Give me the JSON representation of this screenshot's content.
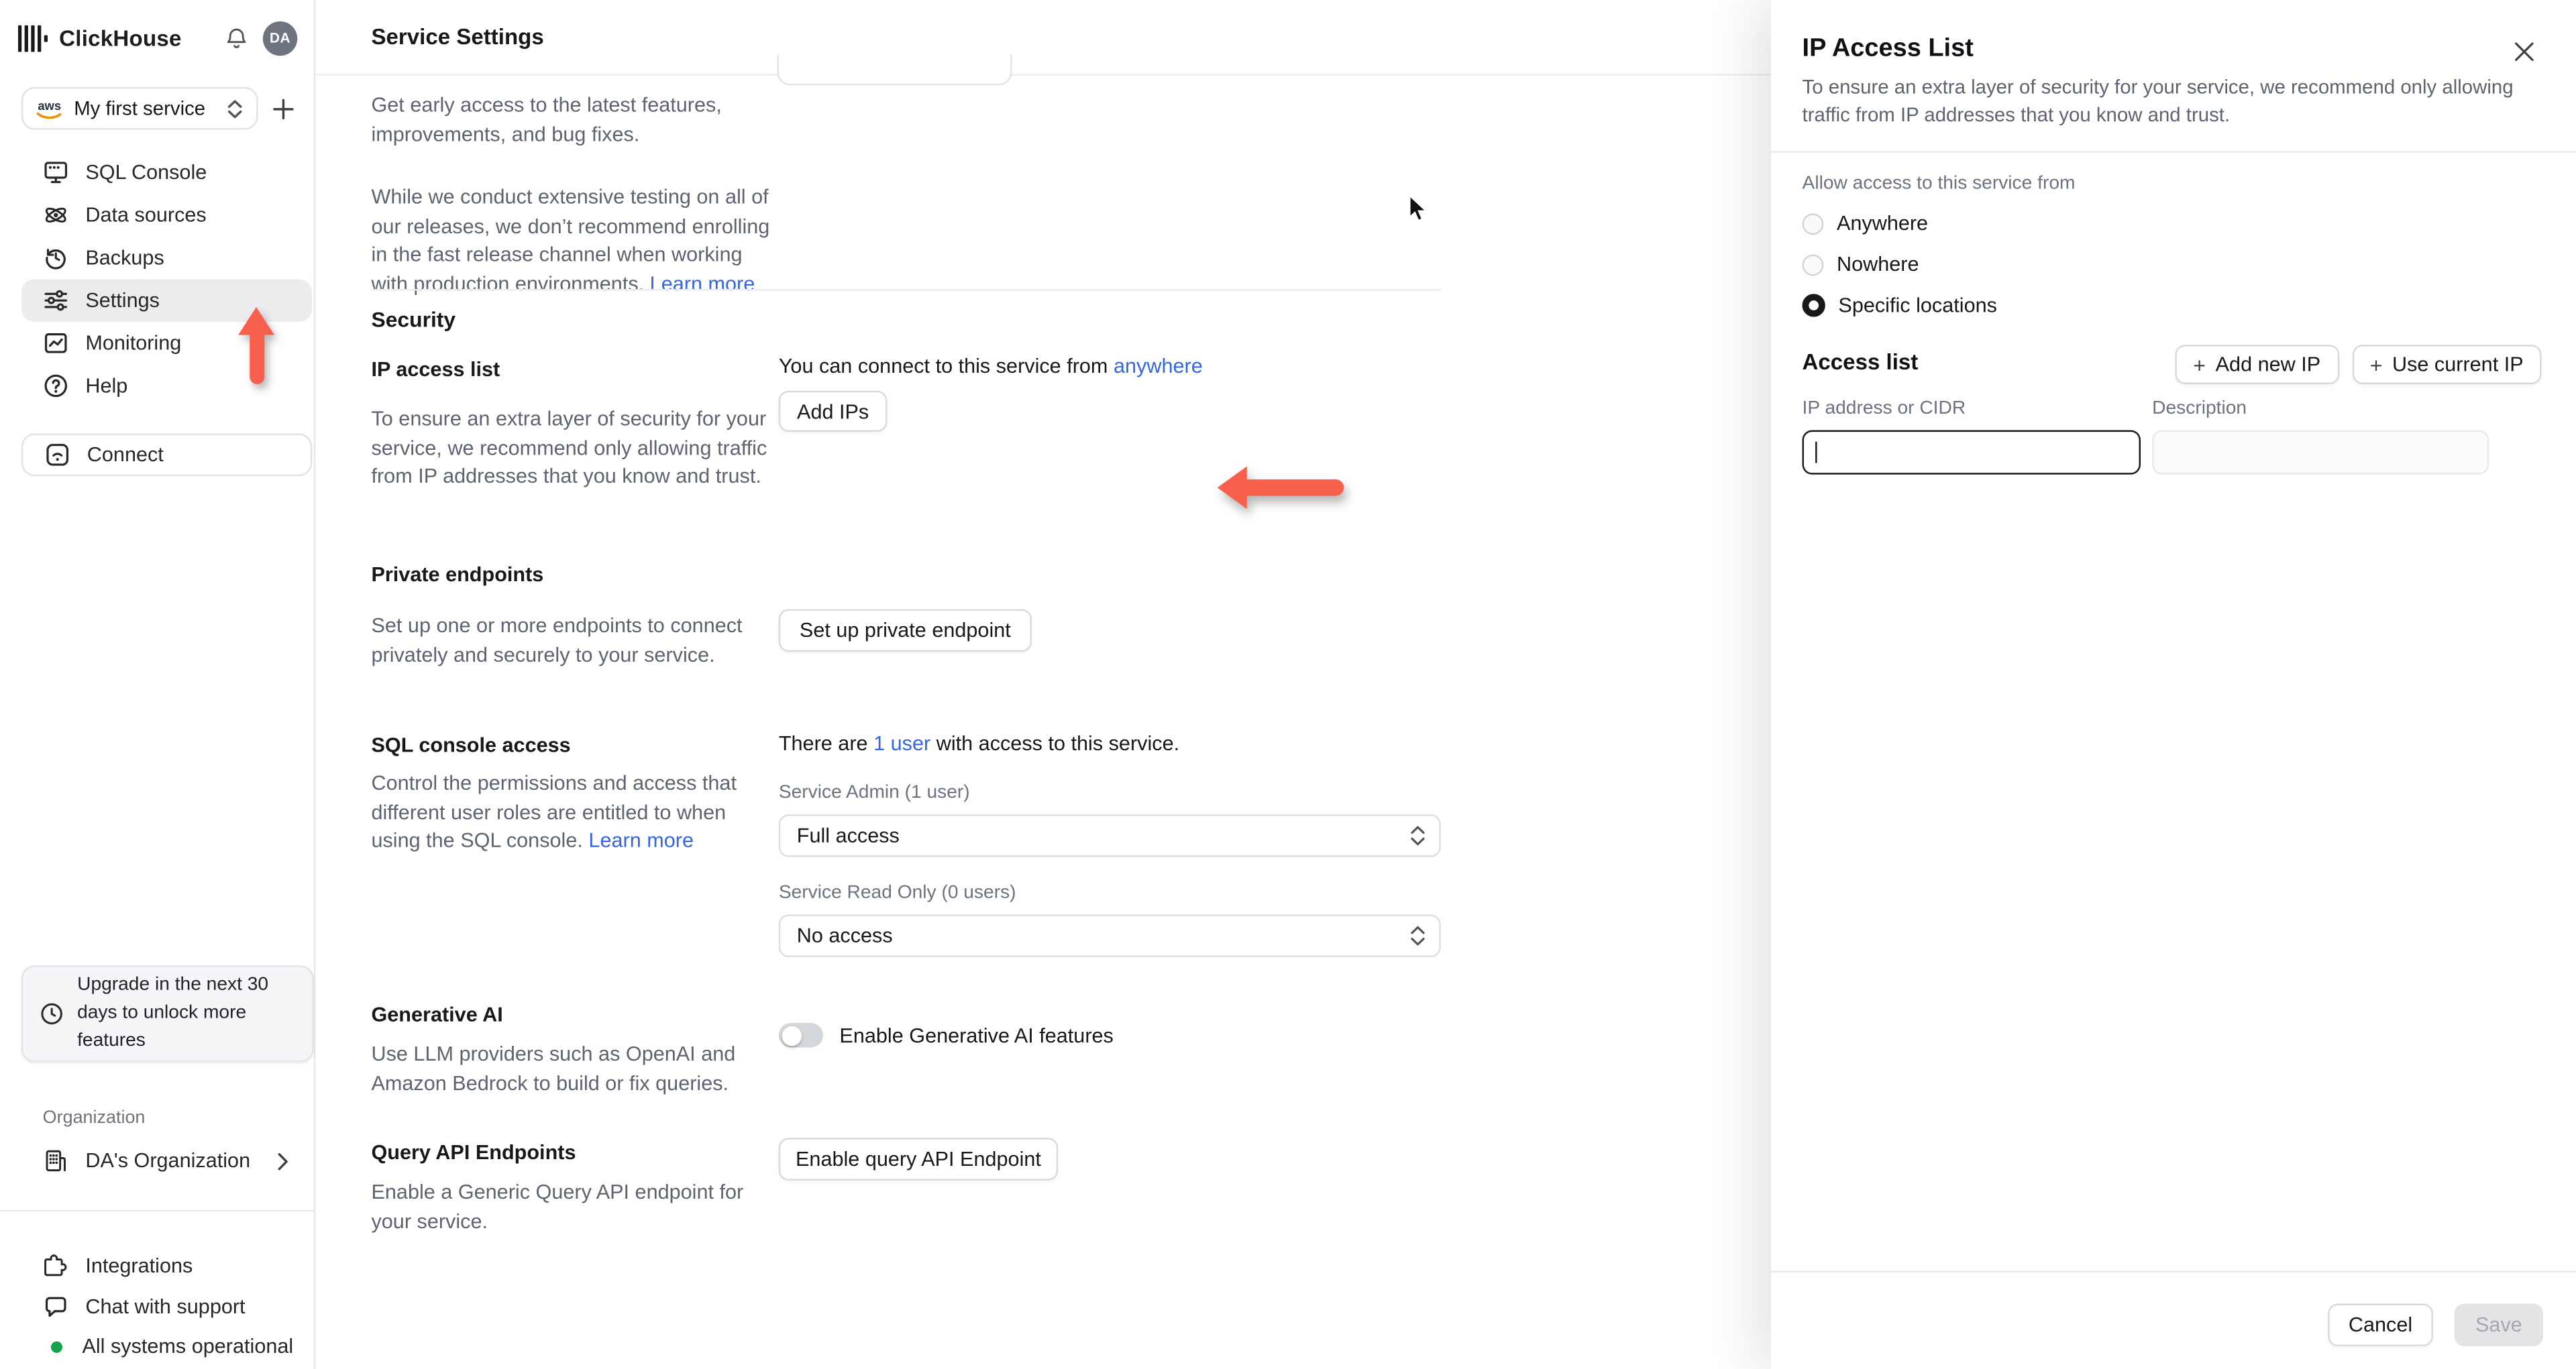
{
  "colors": {
    "accent_red": "#f8604e",
    "link_blue": "#3667e0",
    "status_green": "#17a34a"
  },
  "topbar": {
    "brand": "ClickHouse",
    "avatar_initials": "DA"
  },
  "sidebar": {
    "service_selector": {
      "label": "My first service",
      "provider": "aws"
    },
    "nav": [
      {
        "label": "SQL Console"
      },
      {
        "label": "Data sources"
      },
      {
        "label": "Backups"
      },
      {
        "label": "Settings"
      },
      {
        "label": "Monitoring"
      },
      {
        "label": "Help"
      }
    ],
    "connect_label": "Connect",
    "upgrade_notice": "Upgrade in the next 30 days to unlock more features",
    "organization_section_label": "Organization",
    "organization_name": "DA's Organization",
    "footer": {
      "integrations": "Integrations",
      "chat": "Chat with support",
      "status": "All systems operational"
    }
  },
  "main": {
    "title": "Service Settings",
    "fast_release": {
      "para1": "Get early access to the latest features, improvements, and bug fixes.",
      "para2": "While we conduct extensive testing on all of our releases, we don’t recommend enrolling in the fast release channel when working with production environments.",
      "learn_more": "Learn more"
    },
    "security_heading": "Security",
    "ip_access": {
      "heading": "IP access list",
      "description": "To ensure an extra layer of security for your service, we recommend only allowing traffic from IP addresses that you know and trust.",
      "connect_prefix": "You can connect to this service from",
      "connect_link": "anywhere",
      "add_ips_button": "Add IPs"
    },
    "private_endpoints": {
      "heading": "Private endpoints",
      "description": "Set up one or more endpoints to connect privately and securely to your service.",
      "button": "Set up private endpoint"
    },
    "sql_console_access": {
      "heading": "SQL console access",
      "description": "Control the permissions and access that different user roles are entitled to when using the SQL console.",
      "learn_more": "Learn more",
      "users_prefix": "There are",
      "users_link": "1 user",
      "users_suffix": "with access to this service.",
      "admin_label": "Service Admin (1 user)",
      "admin_value": "Full access",
      "readonly_label": "Service Read Only (0 users)",
      "readonly_value": "No access"
    },
    "generative_ai": {
      "heading": "Generative AI",
      "description": "Use LLM providers such as OpenAI and Amazon Bedrock to build or fix queries.",
      "toggle_label": "Enable Generative AI features",
      "toggle_state": "off"
    },
    "query_api": {
      "heading": "Query API Endpoints",
      "description": "Enable a Generic Query API endpoint for your service.",
      "button": "Enable query API Endpoint"
    }
  },
  "panel": {
    "title": "IP Access List",
    "subtitle": "To ensure an extra layer of security for your service, we recommend only allowing traffic from IP addresses that you know and trust.",
    "allow_label": "Allow access to this service from",
    "options": [
      {
        "label": "Anywhere",
        "selected": false
      },
      {
        "label": "Nowhere",
        "selected": false
      },
      {
        "label": "Specific locations",
        "selected": true
      }
    ],
    "access_list_heading": "Access list",
    "add_new_ip_button": "Add new IP",
    "use_current_ip_button": "Use current IP",
    "ip_label": "IP address or CIDR",
    "desc_label": "Description",
    "ip_value": "",
    "desc_value": "",
    "cancel_button": "Cancel",
    "save_button": "Save"
  }
}
